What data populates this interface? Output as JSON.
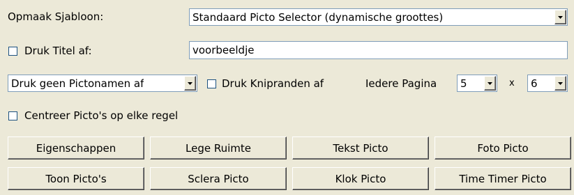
{
  "layout_template": {
    "label": "Opmaak Sjabloon:",
    "selected": "Standaard Picto Selector (dynamische groottes)"
  },
  "print_title": {
    "label": "Druk Titel af:",
    "checked": false,
    "value": "voorbeeldje"
  },
  "picto_names": {
    "selected": "Druk geen Pictonamen af"
  },
  "crop_marks": {
    "label": "Druk Knipranden af",
    "checked": false
  },
  "per_page": {
    "label": "Iedere Pagina",
    "columns": "5",
    "separator": "x",
    "rows": "6"
  },
  "center_pictos": {
    "label": "Centreer Picto's op elke regel",
    "checked": false
  },
  "buttons": {
    "properties": "Eigenschappen",
    "empty_space": "Lege Ruimte",
    "text_picto": "Tekst Picto",
    "photo_picto": "Foto Picto",
    "show_pictos": "Toon Picto's",
    "sclera_picto": "Sclera Picto",
    "clock_picto": "Klok Picto",
    "time_timer_picto": "Time Timer Picto"
  }
}
